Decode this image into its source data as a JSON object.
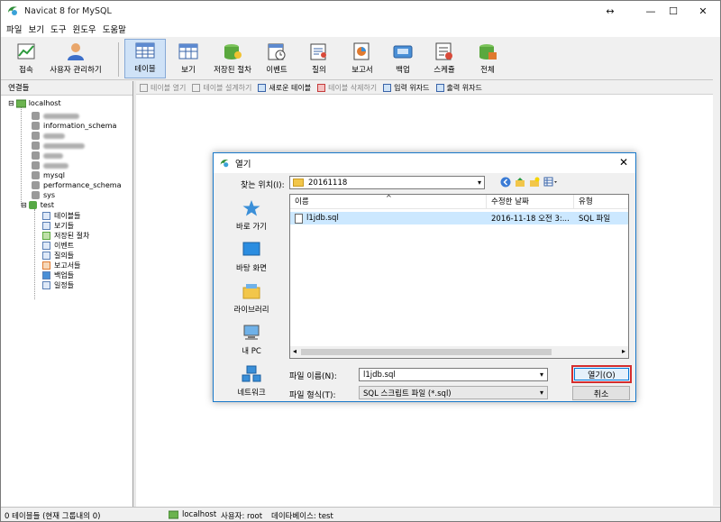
{
  "window": {
    "title": "Navicat 8 for MySQL"
  },
  "menu": [
    "파일",
    "보기",
    "도구",
    "윈도우",
    "도움말"
  ],
  "toolbar": {
    "left": [
      {
        "label": "접속",
        "icon": "connection-icon"
      },
      {
        "label": "사용자 관리하기",
        "icon": "user-manager-icon"
      }
    ],
    "right": [
      {
        "label": "테이블",
        "icon": "table-icon"
      },
      {
        "label": "보기",
        "icon": "view-icon"
      },
      {
        "label": "저장된 절차",
        "icon": "procedure-icon"
      },
      {
        "label": "이벤트",
        "icon": "event-icon"
      },
      {
        "label": "질의",
        "icon": "query-icon"
      },
      {
        "label": "보고서",
        "icon": "report-icon"
      },
      {
        "label": "백업",
        "icon": "backup-icon"
      },
      {
        "label": "스케쥴",
        "icon": "schedule-icon"
      },
      {
        "label": "전체",
        "icon": "all-icon"
      }
    ]
  },
  "left_panel": {
    "header": "연결들",
    "connection": "localhost",
    "databases": [
      "",
      "information_schema",
      "",
      "",
      "",
      "",
      "mysql",
      "performance_schema",
      "sys"
    ],
    "open_database": "test",
    "children": [
      "테이블들",
      "보기들",
      "저장된 절차",
      "이벤트",
      "질의들",
      "보고서들",
      "백업들",
      "일정들"
    ]
  },
  "sub_toolbar": [
    "테이블 열기",
    "테이블 설계하기",
    "새로운 테이블",
    "테이블 삭제하기",
    "입력 위자드",
    "출력 위자드"
  ],
  "status": {
    "left": "0 테이블들 (현재 그룹내의 0)",
    "connection": "localhost",
    "user": "사용자: root",
    "database": "데이타베이스: test"
  },
  "dialog": {
    "title": "열기",
    "look_in_label": "찾는 위치(I):",
    "look_in_value": "20161118",
    "places": [
      "바로 가기",
      "바탕 화면",
      "라이브러리",
      "내 PC",
      "네트워크"
    ],
    "columns": [
      "이름",
      "수정한 날짜",
      "유형"
    ],
    "files": [
      {
        "name": "l1jdb.sql",
        "date": "2016-11-18 오전 3:...",
        "type": "SQL 파일"
      }
    ],
    "filename_label": "파일 이름(N):",
    "filename_value": "l1jdb.sql",
    "filetype_label": "파일 형식(T):",
    "filetype_value": "SQL 스크립트 파일 (*.sql)",
    "open_button": "열기(O)",
    "cancel_button": "취소"
  }
}
